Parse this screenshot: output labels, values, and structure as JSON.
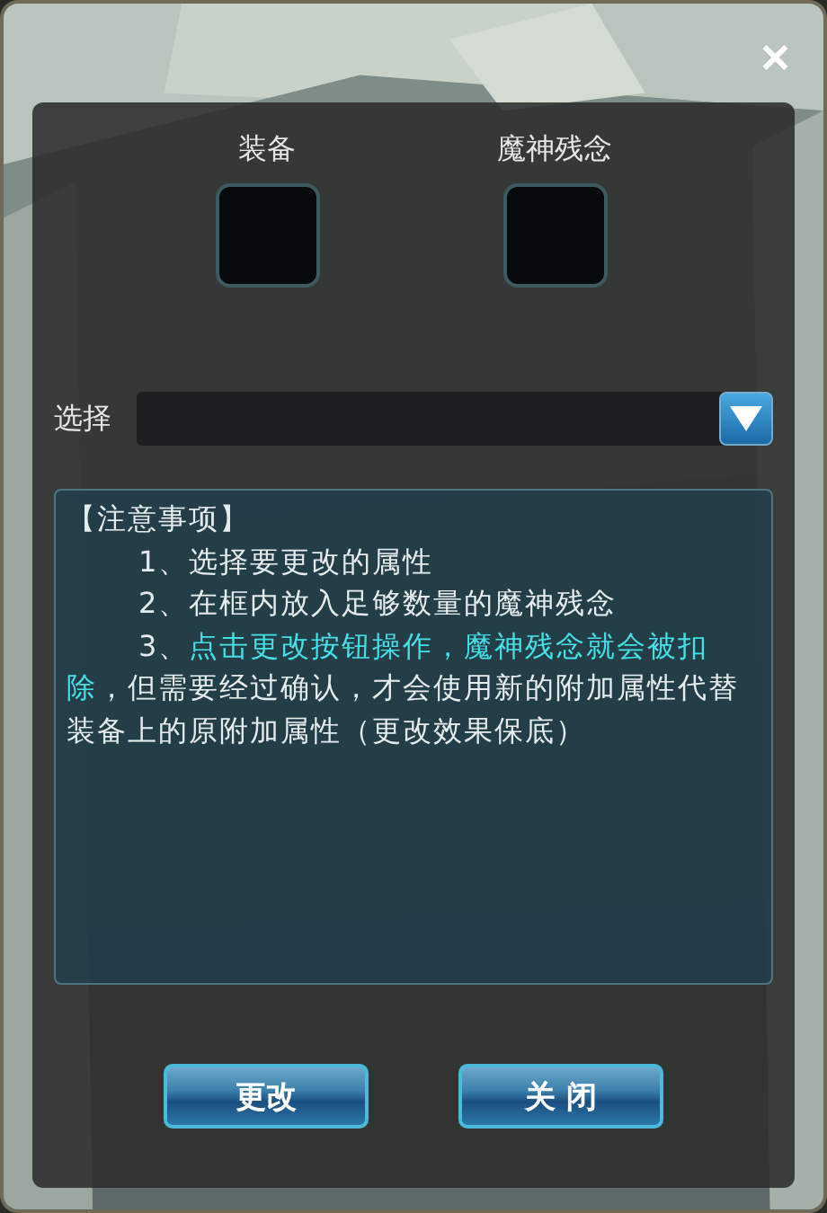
{
  "close_icon": "✕",
  "slots": [
    {
      "label": "装备"
    },
    {
      "label": "魔神残念"
    }
  ],
  "select": {
    "label": "选择"
  },
  "notes": {
    "title": "【注意事项】",
    "items": [
      {
        "segments": [
          {
            "text": "1、选择要更改的属性",
            "highlight": false
          }
        ]
      },
      {
        "segments": [
          {
            "text": "2、在框内放入足够数量的魔神残念",
            "highlight": false
          }
        ]
      },
      {
        "segments": [
          {
            "text": "3、",
            "highlight": false
          },
          {
            "text": "点击更改按钮操作，魔神残念就会被扣除",
            "highlight": true
          },
          {
            "text": "，但需要经过确认，才会使用新的附加属性代替装备上的原附加属性（更改效果保底）",
            "highlight": false
          }
        ]
      }
    ]
  },
  "buttons": [
    {
      "label": "更改"
    },
    {
      "label": "关 闭"
    }
  ]
}
